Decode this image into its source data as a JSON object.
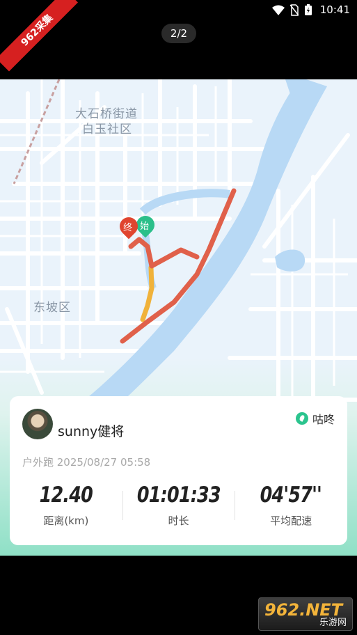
{
  "status_bar": {
    "time": "10:41"
  },
  "ribbon": {
    "text": "962采集"
  },
  "pager": {
    "text": "2/2"
  },
  "map": {
    "labels": [
      "大石桥街道",
      "白玉社区",
      "东坡区"
    ],
    "start_marker": "始",
    "end_marker": "终",
    "route_color": "#e0604a",
    "river_color": "#b8d9f5"
  },
  "card": {
    "username": "sunny健将",
    "brand": "咕咚",
    "activity": "户外跑 2025/08/27 05:58",
    "stats": [
      {
        "value": "12.40",
        "label": "距离(km)"
      },
      {
        "value": "01:01:33",
        "label": "时长"
      },
      {
        "value": "04'57''",
        "label": "平均配速"
      }
    ]
  },
  "watermark": {
    "main": "962.NET",
    "sub": "乐游网"
  }
}
